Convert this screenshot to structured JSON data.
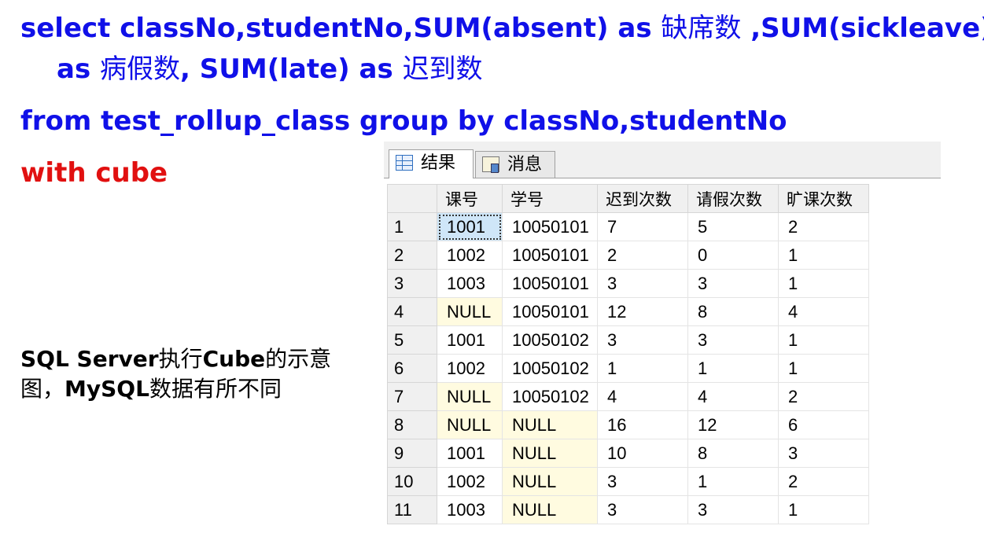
{
  "sql": {
    "line1_a": "select classNo,studentNo,SUM(absent) as ",
    "line1_cjk": "缺席数",
    "line1_b": " ,SUM(sickleave)",
    "line2_a": "as ",
    "line2_cjk": "病假数",
    "line2_b": ", SUM(late) as ",
    "line2_cjk2": "迟到数",
    "line3": "from test_rollup_class group by classNo,studentNo",
    "line4": "with cube"
  },
  "note": {
    "part1": "SQL Server",
    "part2": "执行",
    "part3": "Cube",
    "part4": "的示意图，",
    "part5": "MySQL",
    "part6": "数据有所不同"
  },
  "tabs": [
    {
      "label": "结果",
      "icon": "grid-icon"
    },
    {
      "label": "消息",
      "icon": "messages-icon"
    }
  ],
  "results": {
    "columns": [
      "课号",
      "学号",
      "迟到次数",
      "请假次数",
      "旷课次数"
    ],
    "rows": [
      [
        "1",
        "1001",
        "10050101",
        "7",
        "5",
        "2"
      ],
      [
        "2",
        "1002",
        "10050101",
        "2",
        "0",
        "1"
      ],
      [
        "3",
        "1003",
        "10050101",
        "3",
        "3",
        "1"
      ],
      [
        "4",
        "NULL",
        "10050101",
        "12",
        "8",
        "4"
      ],
      [
        "5",
        "1001",
        "10050102",
        "3",
        "3",
        "1"
      ],
      [
        "6",
        "1002",
        "10050102",
        "1",
        "1",
        "1"
      ],
      [
        "7",
        "NULL",
        "10050102",
        "4",
        "4",
        "2"
      ],
      [
        "8",
        "NULL",
        "NULL",
        "16",
        "12",
        "6"
      ],
      [
        "9",
        "1001",
        "NULL",
        "10",
        "8",
        "3"
      ],
      [
        "10",
        "1002",
        "NULL",
        "3",
        "1",
        "2"
      ],
      [
        "11",
        "1003",
        "NULL",
        "3",
        "3",
        "1"
      ]
    ]
  },
  "colors": {
    "sql": "#1010e8",
    "keyword_red": "#e11010",
    "null_cell": "#fffbe0",
    "selected_cell": "#cfe6f8"
  }
}
